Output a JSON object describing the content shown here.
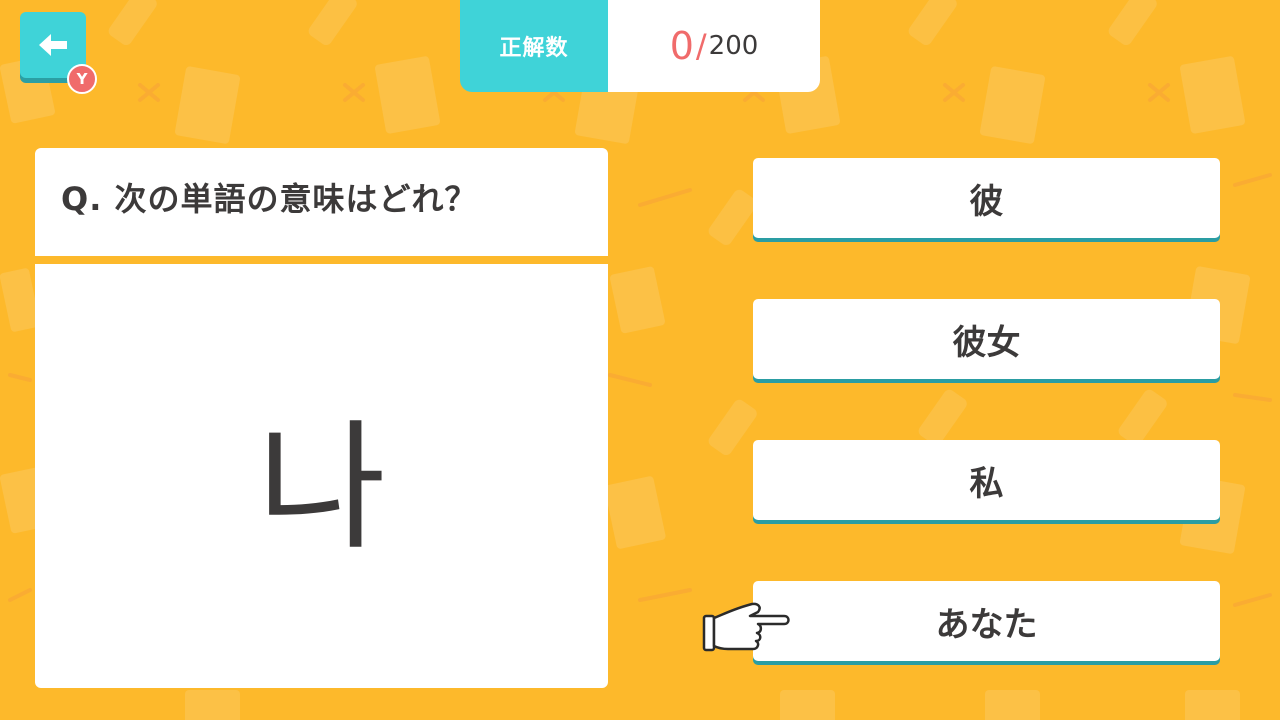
{
  "header": {
    "back_button_badge": "Y",
    "score_label": "正解数",
    "correct_count": "0",
    "separator": "/",
    "total_count": "200"
  },
  "question": {
    "prompt": "Q. 次の単語の意味はどれ？",
    "word": "나"
  },
  "answers": [
    {
      "label": "彼"
    },
    {
      "label": "彼女"
    },
    {
      "label": "私"
    },
    {
      "label": "あなた"
    }
  ],
  "colors": {
    "background": "#fdb92b",
    "accent_teal": "#3fd3d8",
    "answer_shadow": "#2a9da3",
    "score_red": "#f06b6b",
    "text_dark": "#3c3a3a"
  },
  "icons": {
    "back": "left-arrow-icon",
    "badge": "y-button-badge",
    "pointer": "pointing-hand-icon"
  }
}
